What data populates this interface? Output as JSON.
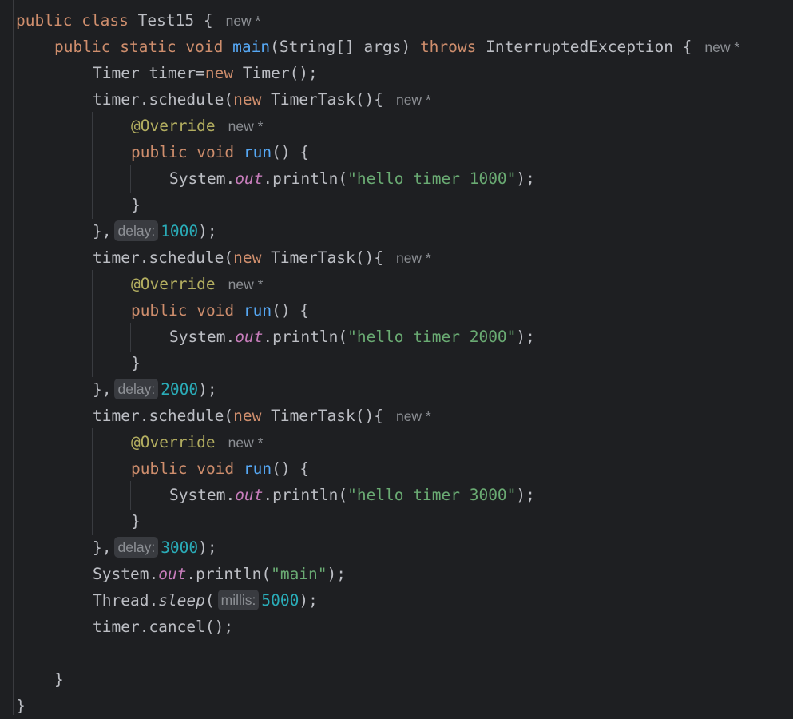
{
  "code": {
    "class_decl": {
      "public": "public",
      "class": "class",
      "name": "Test15",
      "brace": " {",
      "hint": "new *"
    },
    "main_decl": {
      "public": "public",
      "static": "static",
      "void": "void",
      "name": "main",
      "params": "(String[] args) ",
      "throws": "throws",
      "exception": " InterruptedException {",
      "hint": "new *"
    },
    "timer_decl": {
      "text1": "Timer timer=",
      "new": "new",
      "text2": " Timer();"
    },
    "schedule_calls": [
      {
        "prefix": "timer.schedule(",
        "new": "new",
        "type": " TimerTask(){",
        "hint": "new *",
        "override": "@Override",
        "override_hint": "new *",
        "run_public": "public",
        "run_void": "void",
        "run_name": "run",
        "run_rest": "() {",
        "print_prefix": "System.",
        "print_out": "out",
        "print_method": ".println(",
        "print_str": "\"hello timer 1000\"",
        "print_end": ");",
        "close_brace": "}",
        "end_prefix": "},",
        "delay_hint": "delay:",
        "delay_value": "1000",
        "end_suffix": ");"
      },
      {
        "prefix": "timer.schedule(",
        "new": "new",
        "type": " TimerTask(){",
        "hint": "new *",
        "override": "@Override",
        "override_hint": "new *",
        "run_public": "public",
        "run_void": "void",
        "run_name": "run",
        "run_rest": "() {",
        "print_prefix": "System.",
        "print_out": "out",
        "print_method": ".println(",
        "print_str": "\"hello timer 2000\"",
        "print_end": ");",
        "close_brace": "}",
        "end_prefix": "},",
        "delay_hint": "delay:",
        "delay_value": "2000",
        "end_suffix": ");"
      },
      {
        "prefix": "timer.schedule(",
        "new": "new",
        "type": " TimerTask(){",
        "hint": "new *",
        "override": "@Override",
        "override_hint": "new *",
        "run_public": "public",
        "run_void": "void",
        "run_name": "run",
        "run_rest": "() {",
        "print_prefix": "System.",
        "print_out": "out",
        "print_method": ".println(",
        "print_str": "\"hello timer 3000\"",
        "print_end": ");",
        "close_brace": "}",
        "end_prefix": "},",
        "delay_hint": "delay:",
        "delay_value": "3000",
        "end_suffix": ");"
      }
    ],
    "main_print": {
      "prefix": "System.",
      "out": "out",
      "method": ".println(",
      "str": "\"main\"",
      "end": ");"
    },
    "sleep_call": {
      "prefix": "Thread.",
      "method": "sleep",
      "open": "(",
      "hint": "millis:",
      "value": "5000",
      "end": ");"
    },
    "cancel_call": {
      "text": "timer.cancel();"
    },
    "close_main": "}",
    "close_class": "}"
  },
  "colors": {
    "background": "#1e1f22",
    "keyword": "#cf8e6d",
    "function": "#56a8f5",
    "string": "#6aab73",
    "number": "#2aacb8",
    "annotation": "#b3ae60",
    "static_field": "#c77dbb",
    "default_text": "#bcbec4",
    "hint": "#8c8f94"
  }
}
